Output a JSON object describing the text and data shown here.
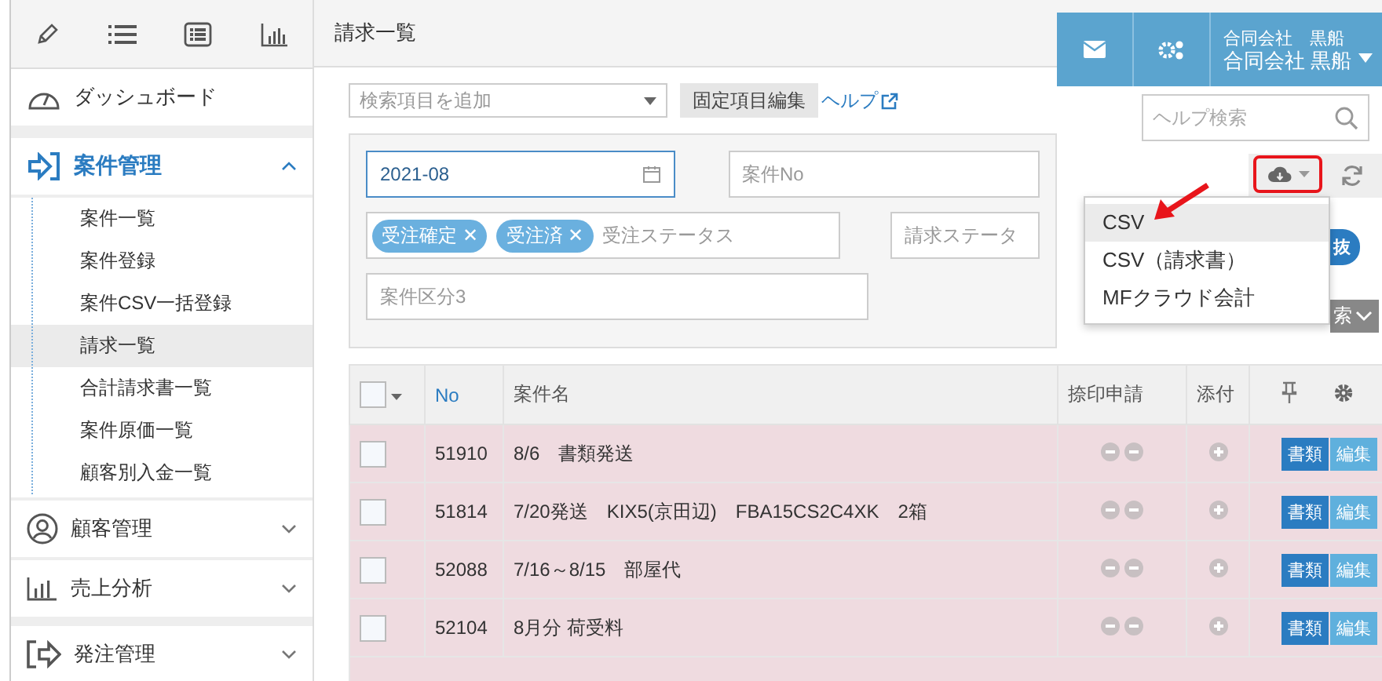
{
  "sidebar": {
    "dashboard": "ダッシュボード",
    "sections": [
      {
        "label": "案件管理",
        "expanded": true,
        "children": [
          {
            "label": "案件一覧",
            "selected": false
          },
          {
            "label": "案件登録",
            "selected": false
          },
          {
            "label": "案件CSV一括登録",
            "selected": false
          },
          {
            "label": "請求一覧",
            "selected": true
          },
          {
            "label": "合計請求書一覧",
            "selected": false
          },
          {
            "label": "案件原価一覧",
            "selected": false
          },
          {
            "label": "顧客別入金一覧",
            "selected": false
          }
        ]
      },
      {
        "label": "顧客管理",
        "expanded": false
      },
      {
        "label": "売上分析",
        "expanded": false
      },
      {
        "label": "発注管理",
        "expanded": false
      }
    ]
  },
  "page_title": "請求一覧",
  "search_bar": {
    "placeholder": "検索項目を追加",
    "fixed_button": "固定項目編集",
    "help_link": "ヘルプ"
  },
  "filters": {
    "date": {
      "value": "2021-08"
    },
    "case_no": {
      "placeholder": "案件No"
    },
    "order_status": {
      "tags": [
        {
          "label": "受注確定",
          "remove": "✕"
        },
        {
          "label": "受注済",
          "remove": "✕"
        }
      ],
      "placeholder": "受注ステータス"
    },
    "billing_status": {
      "placeholder": "請求ステータ"
    },
    "case_type": {
      "placeholder": "案件区分3"
    }
  },
  "header": {
    "company_lines": [
      "合同会社　黒船",
      "合同会社 黒船"
    ],
    "help_search": {
      "placeholder": "ヘルプ検索"
    }
  },
  "download_menu": {
    "expanded": true,
    "items": [
      {
        "label": "CSV",
        "selected": true
      },
      {
        "label": "CSV（請求書）",
        "selected": false
      },
      {
        "label": "MFクラウド会計",
        "selected": false
      }
    ]
  },
  "covered_buttons": [
    "抜",
    "索"
  ],
  "table": {
    "select_all_checked": false,
    "columns": [
      "No",
      "案件名",
      "捺印申請",
      "添付"
    ],
    "rows": [
      {
        "checked": false,
        "no": "51910",
        "name": "8/6　書類発送",
        "doc_button": "書類",
        "edit_button": "編集"
      },
      {
        "checked": false,
        "no": "51814",
        "name": "7/20発送　KIX5(京田辺)　FBA15CS2C4XK　2箱",
        "doc_button": "書類",
        "edit_button": "編集"
      },
      {
        "checked": false,
        "no": "52088",
        "name": "7/16～8/15　部屋代",
        "doc_button": "書類",
        "edit_button": "編集"
      },
      {
        "checked": false,
        "no": "52104",
        "name": "8月分 荷受料",
        "doc_button": "書類",
        "edit_button": "編集"
      }
    ]
  }
}
